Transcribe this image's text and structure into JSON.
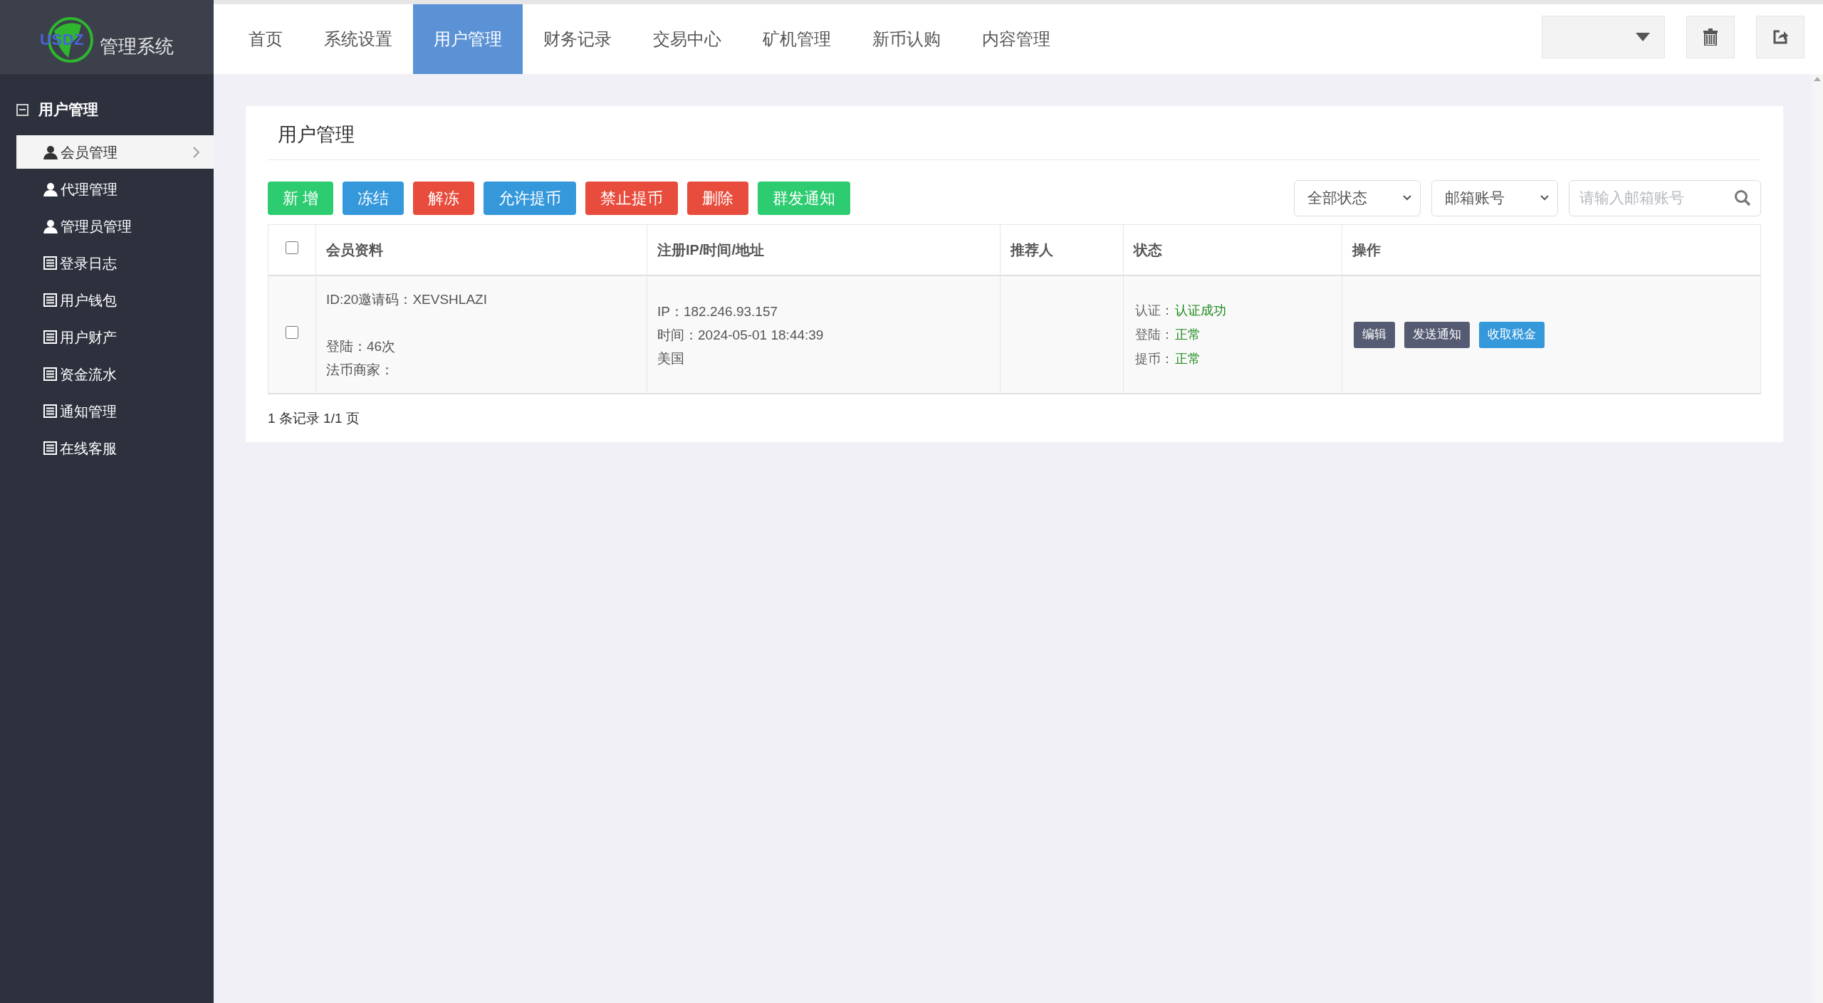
{
  "logo": {
    "mark": "USDZ",
    "title": "管理系统"
  },
  "nav": [
    {
      "label": "首页",
      "selected": false
    },
    {
      "label": "系统设置",
      "selected": false
    },
    {
      "label": "用户管理",
      "selected": true
    },
    {
      "label": "财务记录",
      "selected": false
    },
    {
      "label": "交易中心",
      "selected": false
    },
    {
      "label": "矿机管理",
      "selected": false
    },
    {
      "label": "新币认购",
      "selected": false
    },
    {
      "label": "内容管理",
      "selected": false
    }
  ],
  "sidebar": {
    "group": {
      "label": "用户管理",
      "expanded": true
    },
    "items": [
      {
        "label": "会员管理",
        "kind": "user",
        "selected": true
      },
      {
        "label": "代理管理",
        "kind": "user",
        "selected": false
      },
      {
        "label": "管理员管理",
        "kind": "user",
        "selected": false
      },
      {
        "label": "登录日志",
        "kind": "list",
        "selected": false
      },
      {
        "label": "用户钱包",
        "kind": "list",
        "selected": false
      },
      {
        "label": "用户财产",
        "kind": "list",
        "selected": false
      },
      {
        "label": "资金流水",
        "kind": "list",
        "selected": false
      },
      {
        "label": "通知管理",
        "kind": "list",
        "selected": false
      },
      {
        "label": "在线客服",
        "kind": "list",
        "selected": false
      }
    ]
  },
  "card": {
    "title": "用户管理",
    "buttons": [
      {
        "label": "新 增",
        "color": "#2ecc71"
      },
      {
        "label": "冻结",
        "color": "#3498db"
      },
      {
        "label": "解冻",
        "color": "#e74c3c"
      },
      {
        "label": "允许提币",
        "color": "#3498db"
      },
      {
        "label": "禁止提币",
        "color": "#e74c3c"
      },
      {
        "label": "删除",
        "color": "#e74c3c"
      },
      {
        "label": "群发通知",
        "color": "#2ecc71"
      }
    ],
    "filters": [
      {
        "value": "全部状态"
      },
      {
        "value": "邮箱账号"
      }
    ],
    "search": {
      "placeholder": "请输入邮箱账号"
    },
    "table": {
      "columns": [
        "会员资料",
        "注册IP/时间/地址",
        "推荐人",
        "状态",
        "操作"
      ],
      "header_checked": false,
      "rows": [
        {
          "checked": false,
          "member": [
            "ID:20邀请码：XEVSHLAZI",
            "登陆：46次",
            "法币商家："
          ],
          "registration": [
            "IP：182.246.93.157",
            "时间：2024-05-01 18:44:39",
            "美国"
          ],
          "status": [
            {
              "label": "认证：",
              "value": "认证成功"
            },
            {
              "label": "登陆：",
              "value": "正常"
            },
            {
              "label": "提币：",
              "value": "正常"
            }
          ],
          "actions": [
            {
              "label": "编辑",
              "color": "#555b73"
            },
            {
              "label": "发送通知",
              "color": "#555b73"
            },
            {
              "label": "收取税金",
              "color": "#3498db"
            }
          ]
        }
      ]
    },
    "footer": "1 条记录 1/1 页"
  }
}
